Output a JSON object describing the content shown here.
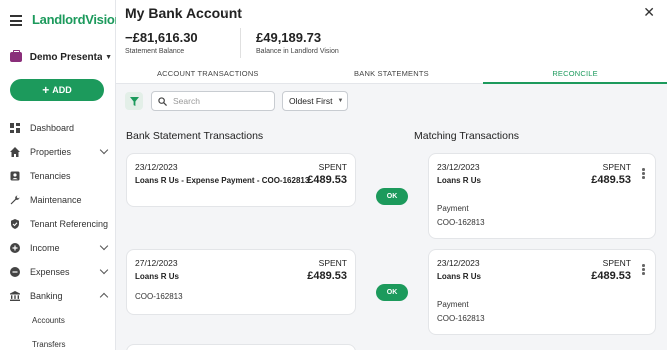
{
  "sidebar": {
    "logo_text": "LandlordVision",
    "org_name": "Demo Presentati...",
    "add_label": "ADD",
    "nav": [
      {
        "label": "Dashboard",
        "icon": "dashboard-icon"
      },
      {
        "label": "Properties",
        "icon": "home-icon"
      },
      {
        "label": "Tenancies",
        "icon": "contact-icon"
      },
      {
        "label": "Maintenance",
        "icon": "wrench-icon"
      },
      {
        "label": "Tenant Referencing",
        "icon": "shield-icon"
      },
      {
        "label": "Income",
        "icon": "plus-circle-icon"
      },
      {
        "label": "Expenses",
        "icon": "minus-circle-icon"
      },
      {
        "label": "Banking",
        "icon": "bank-icon"
      }
    ],
    "sub_nav": [
      "Accounts",
      "Transfers"
    ]
  },
  "header": {
    "title": "My Bank Account",
    "statement_balance": "−£81,616.30",
    "statement_balance_label": "Statement Balance",
    "lv_balance": "£49,189.73",
    "lv_balance_label": "Balance in Landlord Vision"
  },
  "tabs": [
    "ACCOUNT TRANSACTIONS",
    "BANK STATEMENTS",
    "RECONCILE"
  ],
  "toolbar": {
    "search_placeholder": "Search",
    "sort_value": "Oldest First"
  },
  "reconcile": {
    "bank_title": "Bank Statement Transactions",
    "match_title": "Matching Transactions",
    "ok_label": "OK",
    "bank_transactions": [
      {
        "date": "23/12/2023",
        "type": "SPENT",
        "payee": "Loans R Us - Expense Payment - COO-162813",
        "amount": "£489.53"
      },
      {
        "date": "27/12/2023",
        "type": "SPENT",
        "payee": "Loans R Us",
        "amount": "£489.53",
        "ref": "COO-162813"
      }
    ],
    "matching_transactions": [
      {
        "date": "23/12/2023",
        "type": "SPENT",
        "payee": "Loans R Us",
        "amount": "£489.53",
        "category": "Payment",
        "ref": "COO-162813"
      },
      {
        "date": "23/12/2023",
        "type": "SPENT",
        "payee": "Loans R Us",
        "amount": "£489.53",
        "category": "Payment",
        "ref": "COO-162813"
      }
    ]
  },
  "colors": {
    "accent": "#1c9a5c",
    "org_icon": "#8a2e7a"
  }
}
